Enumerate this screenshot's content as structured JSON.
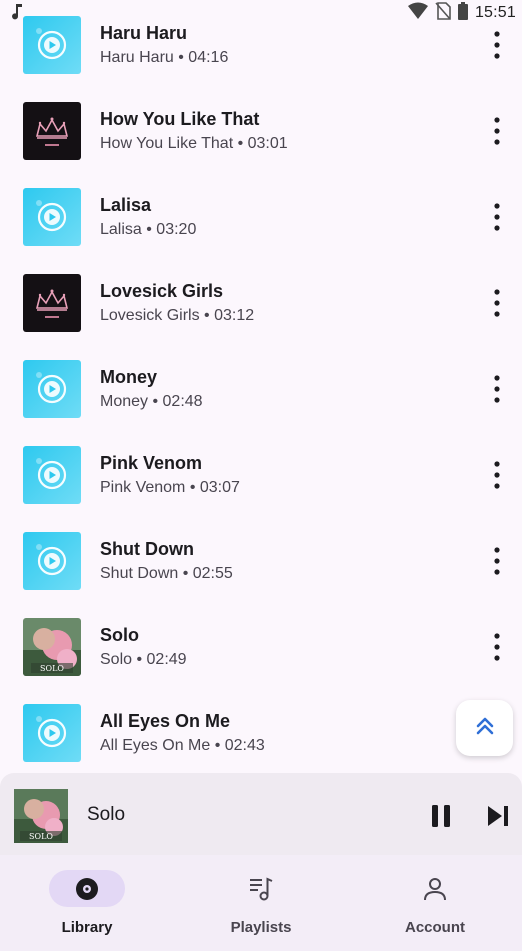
{
  "status_bar": {
    "time": "15:51",
    "icons": [
      "music-note-icon",
      "wifi-icon",
      "no-sim-icon",
      "battery-icon"
    ]
  },
  "songs": [
    {
      "title": "Haru Haru",
      "subtitle": "Haru Haru • 04:16",
      "art": "default-blue"
    },
    {
      "title": "How You Like That",
      "subtitle": "How You Like That • 03:01",
      "art": "crown-black"
    },
    {
      "title": "Lalisa",
      "subtitle": "Lalisa • 03:20",
      "art": "default-blue"
    },
    {
      "title": "Lovesick Girls",
      "subtitle": "Lovesick Girls • 03:12",
      "art": "crown-black"
    },
    {
      "title": "Money",
      "subtitle": "Money • 02:48",
      "art": "default-blue"
    },
    {
      "title": "Pink Venom",
      "subtitle": "Pink Venom • 03:07",
      "art": "default-blue"
    },
    {
      "title": "Shut Down",
      "subtitle": "Shut Down • 02:55",
      "art": "default-blue"
    },
    {
      "title": "Solo",
      "subtitle": "Solo • 02:49",
      "art": "solo-photo"
    },
    {
      "title": "All Eyes On Me",
      "subtitle": "All Eyes On Me • 02:43",
      "art": "default-blue"
    }
  ],
  "album_art_text": {
    "solo": "SOLO"
  },
  "scroll_top_button": {
    "icon": "double-chevron-up-icon"
  },
  "now_playing": {
    "title": "Solo",
    "state": "playing",
    "icons": [
      "pause-icon",
      "skip-next-icon"
    ]
  },
  "nav": {
    "items": [
      {
        "label": "Library",
        "icon": "library-disc-icon",
        "active": true
      },
      {
        "label": "Playlists",
        "icon": "playlist-music-icon",
        "active": false
      },
      {
        "label": "Account",
        "icon": "account-icon",
        "active": false
      }
    ]
  },
  "colors": {
    "background": "#fcf7fd",
    "accent": "#2f6fd6",
    "nav_active_pill": "#e3d8f5",
    "default_art_start": "#2ec9ef",
    "default_art_end": "#6fdcf6"
  }
}
